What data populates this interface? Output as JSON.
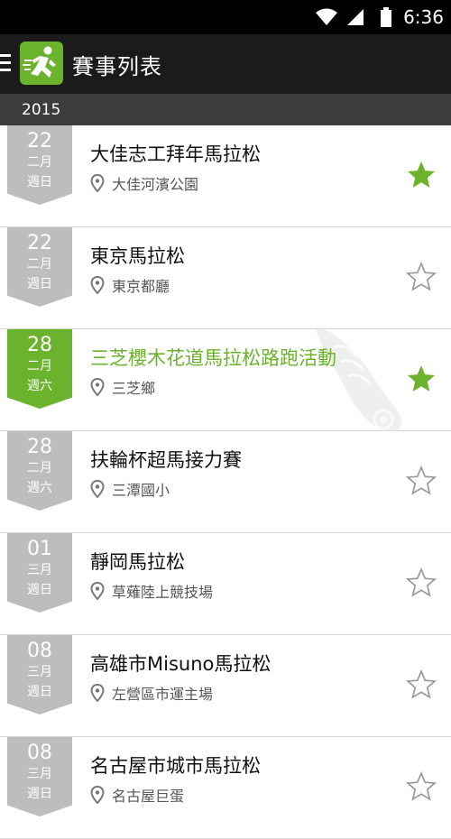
{
  "status_bar": {
    "time": "6:36"
  },
  "app_bar": {
    "title": "賽事列表",
    "logo_icon": "runner-icon",
    "menu_icon": "drawer-menu-icon"
  },
  "section": {
    "year": "2015"
  },
  "colors": {
    "accent": "#6bb22d",
    "badge_gray": "#bdbdbd",
    "app_bar": "#1b1b1b",
    "section_header": "#3c3c3c"
  },
  "events": [
    {
      "day": "22",
      "month": "二月",
      "weekday": "週日",
      "title": "大佳志工拜年馬拉松",
      "location": "大佳河濱公園",
      "starred": true,
      "active": false
    },
    {
      "day": "22",
      "month": "二月",
      "weekday": "週日",
      "title": "東京馬拉松",
      "location": "東京都廳",
      "starred": false,
      "active": false
    },
    {
      "day": "28",
      "month": "二月",
      "weekday": "週六",
      "title": "三芝櫻木花道馬拉松路跑活動",
      "location": "三芝鄉",
      "starred": true,
      "active": true
    },
    {
      "day": "28",
      "month": "二月",
      "weekday": "週六",
      "title": "扶輪杯超馬接力賽",
      "location": "三潭國小",
      "starred": false,
      "active": false
    },
    {
      "day": "01",
      "month": "三月",
      "weekday": "週日",
      "title": "靜岡馬拉松",
      "location": "草薙陸上競技場",
      "starred": false,
      "active": false
    },
    {
      "day": "08",
      "month": "三月",
      "weekday": "週日",
      "title": "高雄市Misuno馬拉松",
      "location": "左營區市運主場",
      "starred": false,
      "active": false
    },
    {
      "day": "08",
      "month": "三月",
      "weekday": "週日",
      "title": "名古屋市城市馬拉松",
      "location": "名古屋巨蛋",
      "starred": false,
      "active": false
    }
  ]
}
